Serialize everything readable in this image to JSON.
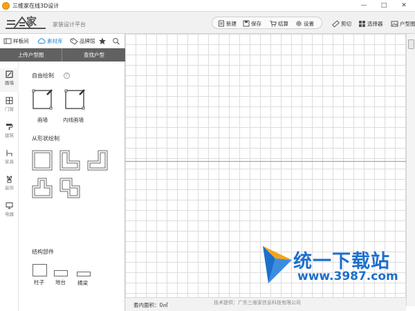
{
  "window": {
    "title": "三维家在线3D设计",
    "controls": {
      "minimize": "—",
      "maximize": "□",
      "close": "✕"
    }
  },
  "header": {
    "logo_text": "家",
    "subtitle": "家装设计平台",
    "toolbar": {
      "new_label": "新建",
      "save_label": "保存",
      "settle_label": "结算",
      "settings_label": "设置"
    },
    "tools": {
      "cut_label": "剪切",
      "selector_label": "选择器",
      "house_label": "户型图"
    }
  },
  "library": {
    "tabs": [
      {
        "label": "样板间",
        "icon": "stack-icon"
      },
      {
        "label": "素材库",
        "icon": "cloud-icon"
      },
      {
        "label": "品牌馆",
        "icon": "tag-icon"
      }
    ],
    "active_tab": "素材库",
    "upload_label": "上传户型图",
    "find_label": "查找户型"
  },
  "categories": [
    {
      "label": "画墙",
      "icon": "pencil-icon",
      "active": true
    },
    {
      "label": "门窗",
      "icon": "door-window-icon",
      "active": false
    },
    {
      "label": "建筑",
      "icon": "paint-roller-icon",
      "active": false
    },
    {
      "label": "家具",
      "icon": "chair-icon",
      "active": false
    },
    {
      "label": "装饰",
      "icon": "plant-icon",
      "active": false
    },
    {
      "label": "电器",
      "icon": "monitor-icon",
      "active": false
    }
  ],
  "sections": {
    "free_draw": {
      "title": "自由绘制",
      "help": "?",
      "items": [
        {
          "label": "画墙"
        },
        {
          "label": "内线画墙"
        }
      ]
    },
    "shape_draw": {
      "title": "从形状绘制"
    },
    "structure": {
      "title": "结构部件",
      "items": [
        {
          "label": "柱子"
        },
        {
          "label": "地台"
        },
        {
          "label": "横梁"
        }
      ]
    }
  },
  "status": {
    "area_text": "套内面积：0㎡",
    "provider_text": "技术提供：广东三维家信息科技有限公司"
  },
  "watermark": {
    "text": "统一下载站",
    "url": "www.3987.com"
  },
  "colors": {
    "accent": "#1f8ad6",
    "upload_bar": "#616161",
    "watermark": "#1d6fcc"
  }
}
